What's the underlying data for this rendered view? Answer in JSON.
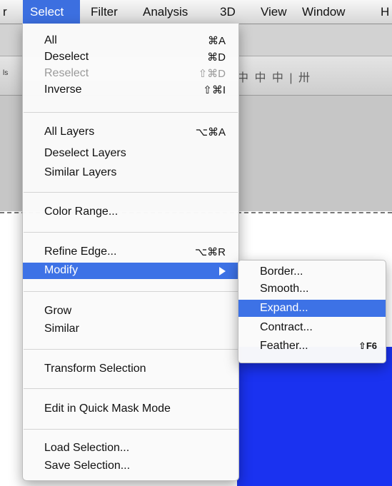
{
  "menubar": {
    "items": [
      {
        "label": "r"
      },
      {
        "label": "Select"
      },
      {
        "label": "Filter"
      },
      {
        "label": "Analysis"
      },
      {
        "label": "3D"
      },
      {
        "label": "View"
      },
      {
        "label": "Window"
      },
      {
        "label": "H"
      }
    ]
  },
  "toolbar": {
    "left_label": "ls",
    "right_icons": "中 中 中 | 卅"
  },
  "select_menu": {
    "items": [
      {
        "label": "All",
        "shortcut": "⌘A"
      },
      {
        "label": "Deselect",
        "shortcut": "⌘D"
      },
      {
        "label": "Reselect",
        "shortcut": "⇧⌘D"
      },
      {
        "label": "Inverse",
        "shortcut": "⇧⌘I"
      },
      {
        "label": "All Layers",
        "shortcut": "⌥⌘A"
      },
      {
        "label": "Deselect Layers",
        "shortcut": ""
      },
      {
        "label": "Similar Layers",
        "shortcut": ""
      },
      {
        "label": "Color Range...",
        "shortcut": ""
      },
      {
        "label": "Refine Edge...",
        "shortcut": "⌥⌘R"
      },
      {
        "label": "Modify",
        "shortcut": ""
      },
      {
        "label": "Grow",
        "shortcut": ""
      },
      {
        "label": "Similar",
        "shortcut": ""
      },
      {
        "label": "Transform Selection",
        "shortcut": ""
      },
      {
        "label": "Edit in Quick Mask Mode",
        "shortcut": ""
      },
      {
        "label": "Load Selection...",
        "shortcut": ""
      },
      {
        "label": "Save Selection...",
        "shortcut": ""
      }
    ]
  },
  "modify_submenu": {
    "items": [
      {
        "label": "Border...",
        "shortcut": ""
      },
      {
        "label": "Smooth...",
        "shortcut": ""
      },
      {
        "label": "Expand...",
        "shortcut": ""
      },
      {
        "label": "Contract...",
        "shortcut": ""
      },
      {
        "label": "Feather...",
        "shortcut": "⇧F6"
      }
    ]
  },
  "colors": {
    "highlight": "#3d72e6",
    "canvas_shape": "#1a32f0"
  }
}
